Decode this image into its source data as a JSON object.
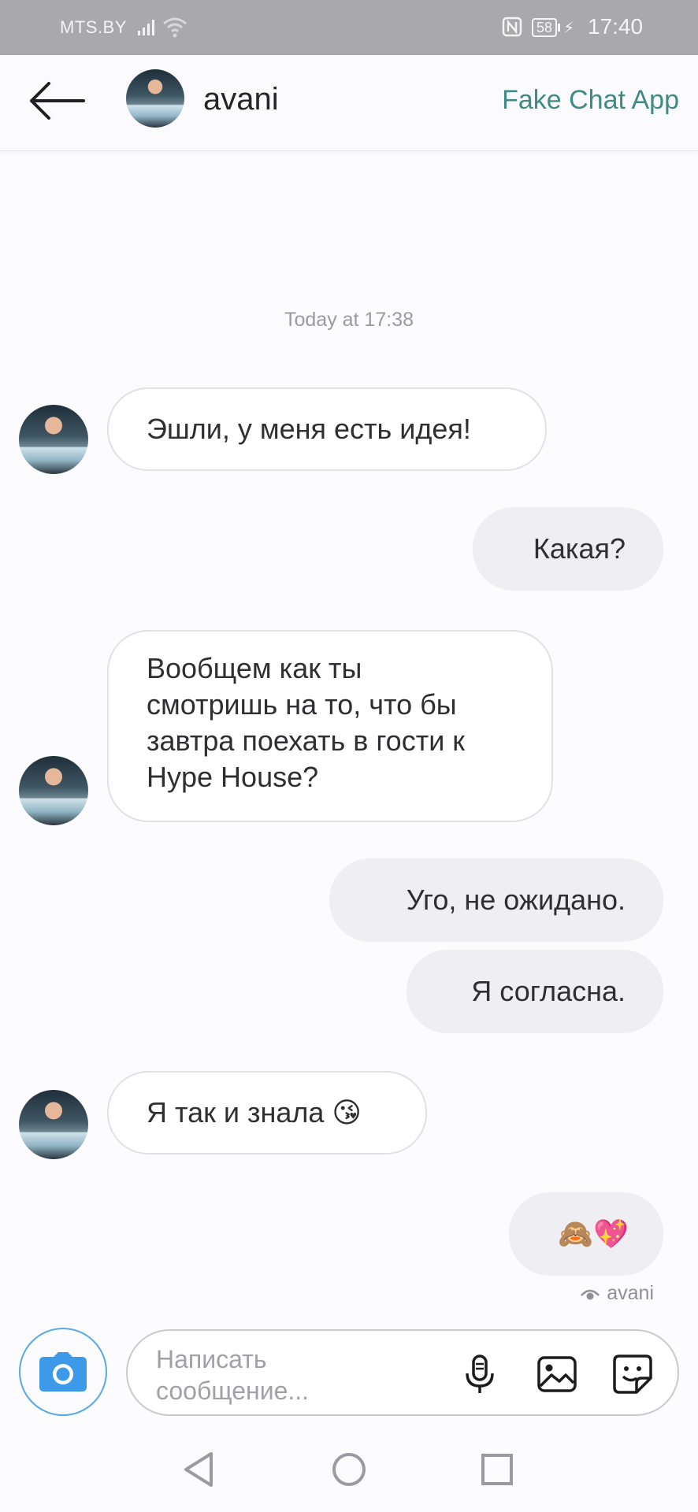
{
  "status_bar": {
    "carrier": "MTS.BY",
    "battery": "58",
    "time": "17:40"
  },
  "header": {
    "contact_name": "avani",
    "app_title": "Fake Chat App"
  },
  "chat": {
    "timestamp": "Today at 17:38",
    "messages": [
      {
        "from": "contact",
        "text": "Эшли, у меня есть идея!"
      },
      {
        "from": "me",
        "text": "Какая?"
      },
      {
        "from": "contact",
        "lines": [
          "Вообщем как ты",
          "смотришь на то, что бы",
          "завтра поехать в гости к",
          "Hype House?"
        ]
      },
      {
        "from": "me",
        "text": "Уго, не ожидано."
      },
      {
        "from": "me",
        "text": "Я согласна."
      },
      {
        "from": "contact",
        "text": "Я так и знала 😘"
      },
      {
        "from": "me",
        "text": "🙈💖"
      }
    ],
    "seen_by": "avani"
  },
  "composer": {
    "placeholder": "Написать\nсообщение..."
  },
  "colors": {
    "accent_teal": "#3f8a85",
    "camera_blue": "#3d9ae8",
    "incoming_bubble": "#ffffff",
    "outgoing_bubble": "#efeef3"
  },
  "icons": {
    "back": "arrow-left-icon",
    "camera": "camera-icon",
    "mic": "microphone-icon",
    "gallery": "image-icon",
    "sticker": "sticker-icon",
    "nav_back": "triangle-back-icon",
    "nav_home": "circle-home-icon",
    "nav_recent": "square-recent-icon"
  }
}
